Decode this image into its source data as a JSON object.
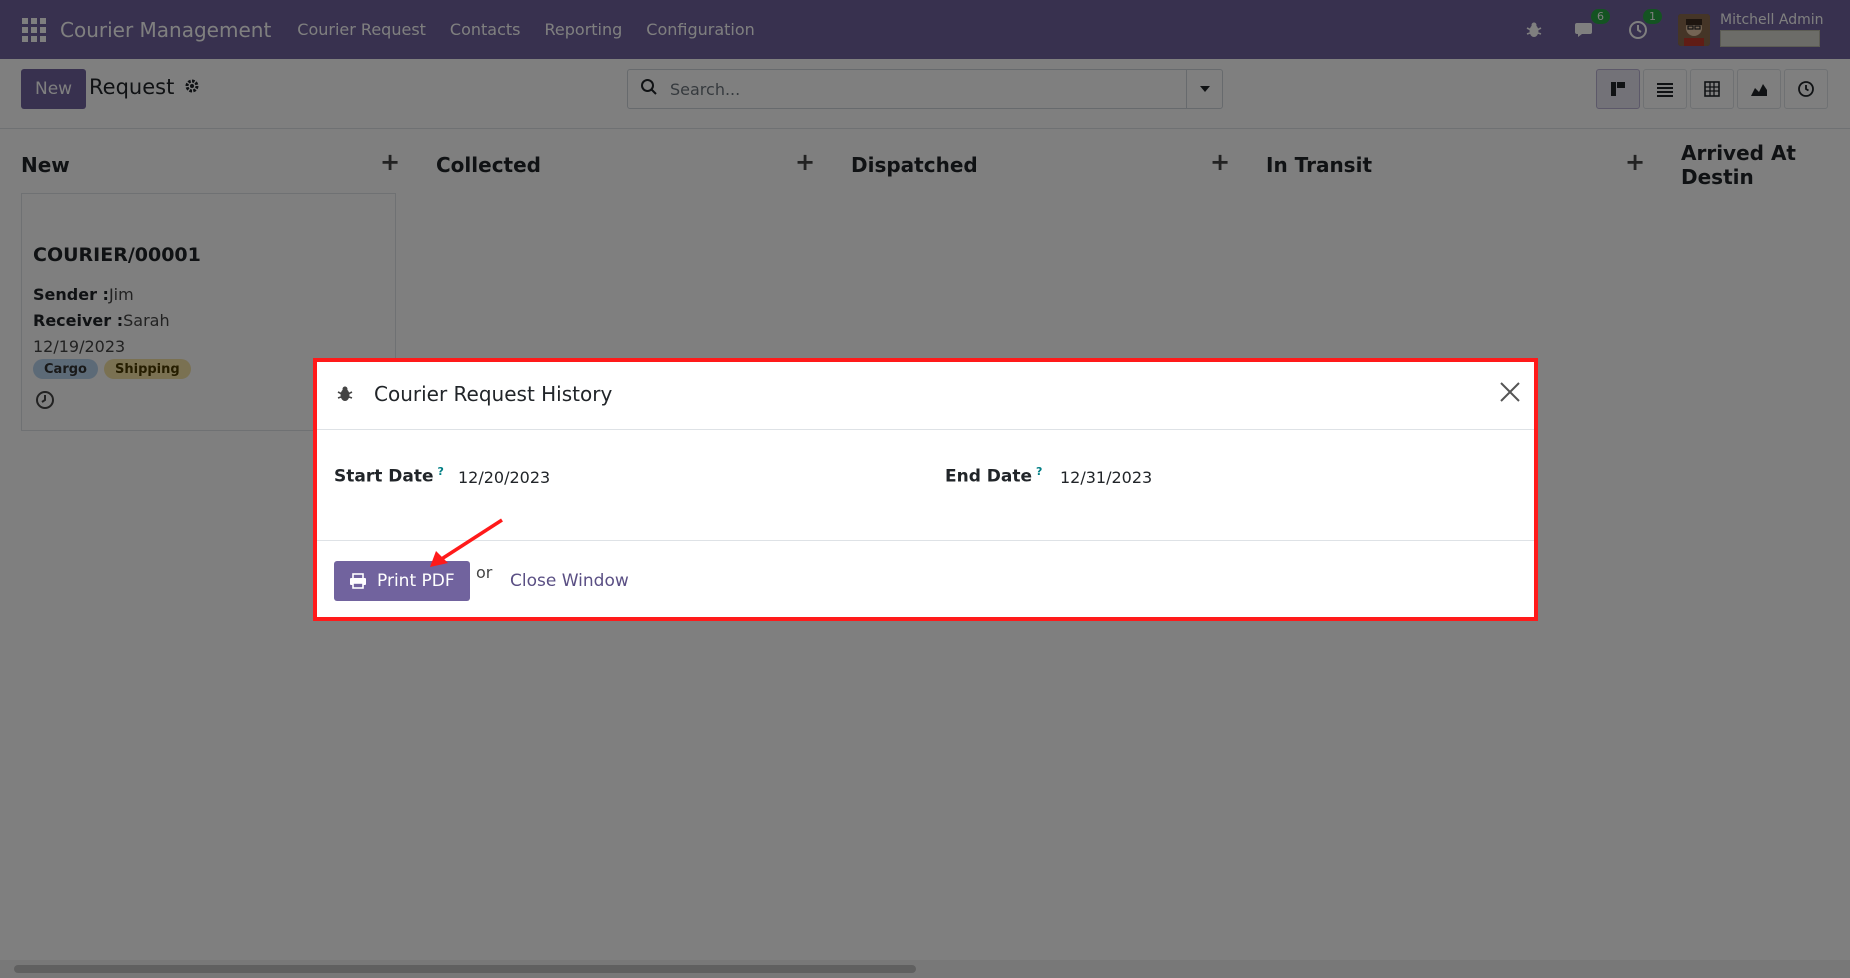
{
  "navbar": {
    "brand": "Courier Management",
    "menu": [
      "Courier Request",
      "Contacts",
      "Reporting",
      "Configuration"
    ],
    "messages_count": "6",
    "activities_count": "1",
    "user_name": "Mitchell Admin"
  },
  "control": {
    "new_label": "New",
    "breadcrumb": "Request",
    "search_placeholder": "Search..."
  },
  "kanban": {
    "columns": [
      "New",
      "Collected",
      "Dispatched",
      "In Transit",
      "Arrived At Destin"
    ],
    "card": {
      "title": "COURIER/00001",
      "sender_label": "Sender :",
      "sender": "Jim",
      "receiver_label": "Receiver :",
      "receiver": "Sarah",
      "date": "12/19/2023",
      "tags": [
        "Cargo",
        "Shipping"
      ]
    }
  },
  "modal": {
    "title": "Courier Request History",
    "start_label": "Start Date",
    "start_value": "12/20/2023",
    "end_label": "End Date",
    "end_value": "12/31/2023",
    "help_mark": "?",
    "print_label": "Print PDF",
    "or_text": "or",
    "close_label": "Close Window"
  },
  "colors": {
    "brand": "#71639e",
    "highlight": "#ff1a1a"
  }
}
